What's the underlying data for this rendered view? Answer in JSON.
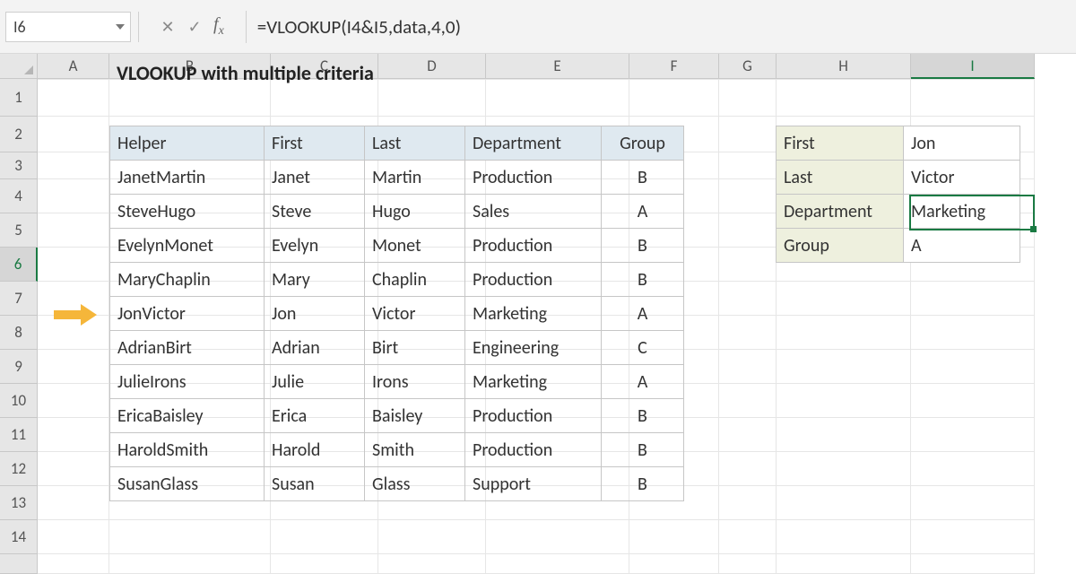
{
  "namebox": "I6",
  "formula": "=VLOOKUP(I4&I5,data,4,0)",
  "columns": [
    "A",
    "B",
    "C",
    "D",
    "E",
    "F",
    "G",
    "H",
    "I"
  ],
  "col_widths_class": [
    "cA",
    "cB",
    "cC",
    "cD",
    "cE",
    "cF",
    "cG",
    "cH",
    "cI"
  ],
  "active_col_index": 8,
  "rows": [
    "1",
    "2",
    "3",
    "4",
    "5",
    "6",
    "7",
    "8",
    "9",
    "10",
    "11",
    "12",
    "13",
    "14"
  ],
  "active_row_index": 5,
  "title": "VLOOKUP with multiple criteria",
  "table": {
    "headers": [
      "Helper",
      "First",
      "Last",
      "Department",
      "Group"
    ],
    "rows": [
      [
        "JanetMartin",
        "Janet",
        "Martin",
        "Production",
        "B"
      ],
      [
        "SteveHugo",
        "Steve",
        "Hugo",
        "Sales",
        "A"
      ],
      [
        "EvelynMonet",
        "Evelyn",
        "Monet",
        "Production",
        "B"
      ],
      [
        "MaryChaplin",
        "Mary",
        "Chaplin",
        "Production",
        "B"
      ],
      [
        "JonVictor",
        "Jon",
        "Victor",
        "Marketing",
        "A"
      ],
      [
        "AdrianBirt",
        "Adrian",
        "Birt",
        "Engineering",
        "C"
      ],
      [
        "JulieIrons",
        "Julie",
        "Irons",
        "Marketing",
        "A"
      ],
      [
        "EricaBaisley",
        "Erica",
        "Baisley",
        "Production",
        "B"
      ],
      [
        "HaroldSmith",
        "Harold",
        "Smith",
        "Production",
        "B"
      ],
      [
        "SusanGlass",
        "Susan",
        "Glass",
        "Support",
        "B"
      ]
    ]
  },
  "lookup": [
    {
      "label": "First",
      "value": "Jon"
    },
    {
      "label": "Last",
      "value": "Victor"
    },
    {
      "label": "Department",
      "value": "Marketing"
    },
    {
      "label": "Group",
      "value": "A"
    }
  ],
  "highlight_data_row": 4
}
